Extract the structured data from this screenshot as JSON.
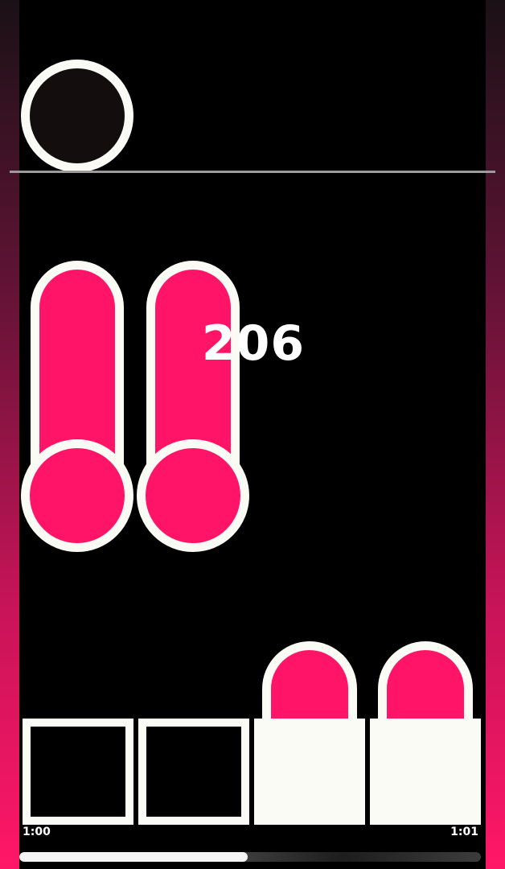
{
  "score": "206",
  "time_elapsed": "1:00",
  "time_total": "1:01",
  "progress": 0.495,
  "colors": {
    "note": "#ff1467",
    "outline": "#fafbf5",
    "background": "#000000",
    "side_gradient_top": "#1a1116",
    "side_gradient_bottom": "#ff1767"
  },
  "lanes": [
    {
      "lane": 1,
      "key_pressed": false,
      "hold_note_visible": true,
      "incoming_note": false
    },
    {
      "lane": 2,
      "key_pressed": false,
      "hold_note_visible": true,
      "incoming_note": false
    },
    {
      "lane": 3,
      "key_pressed": true,
      "hold_note_visible": false,
      "incoming_note": true
    },
    {
      "lane": 4,
      "key_pressed": true,
      "hold_note_visible": false,
      "incoming_note": true
    }
  ]
}
